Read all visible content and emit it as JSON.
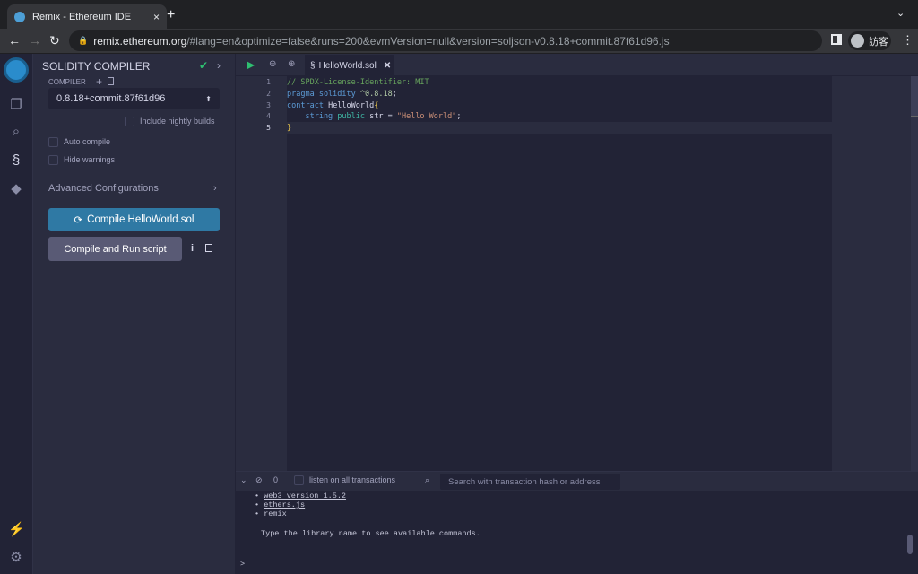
{
  "browser": {
    "tab_title": "Remix - Ethereum IDE",
    "tab_close": "×",
    "new_tab": "+",
    "url_host": "remix.ethereum.org",
    "url_rest": "/#lang=en&optimize=false&runs=200&evmVersion=null&version=soljson-v0.8.18+commit.87f61d96.js",
    "profile_name": "訪客"
  },
  "icons": {
    "left": [
      "file-explorer-icon",
      "search-icon",
      "solidity-compiler-icon",
      "deploy-run-icon"
    ],
    "bottom": [
      "plugin-icon",
      "settings-icon"
    ]
  },
  "side_panel": {
    "title": "SOLIDITY COMPILER",
    "compiler_label": "COMPILER",
    "compiler_version": "0.8.18+commit.87f61d96",
    "nightly_label": "Include nightly builds",
    "auto_compile_label": "Auto compile",
    "hide_warnings_label": "Hide warnings",
    "advanced_label": "Advanced Configurations",
    "compile_button": "Compile HelloWorld.sol",
    "run_script_button": "Compile and Run script",
    "info": "i"
  },
  "editor": {
    "file_tab": "HelloWorld.sol",
    "line_numbers": [
      "1",
      "2",
      "3",
      "4",
      "5"
    ],
    "lines": {
      "l1": "// SPDX-License-Identifier: MIT",
      "l2_kw": "pragma solidity",
      "l2_ver": " ^0.8.18",
      "l2_end": ";",
      "l3_kw": "contract",
      "l3_name": " HelloWorld",
      "l3_brace": "{",
      "l4_type": "    string",
      "l4_kw": " public",
      "l4_mid": " str = ",
      "l4_str": "\"Hello World\"",
      "l4_end": ";",
      "l5": "}"
    }
  },
  "terminal": {
    "count": "0",
    "listen_label": "listen on all transactions",
    "search_placeholder": "Search with transaction hash or address",
    "libs": [
      "web3 version 1.5.2",
      "ethers.js",
      "remix"
    ],
    "hint": "Type the library name to see available commands.",
    "prompt": ">"
  },
  "colors": {
    "accent": "#2f79a4",
    "success": "#2fbf71",
    "panel": "#2a2c3f",
    "background": "#222336"
  }
}
